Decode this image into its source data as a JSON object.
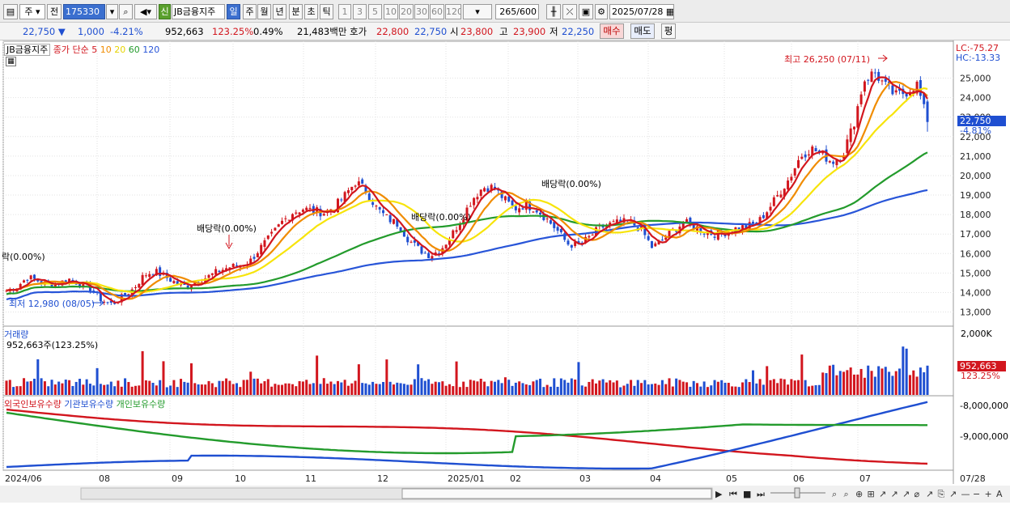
{
  "toolbar": {
    "period_unit": "주",
    "prev": "전",
    "code": "175330",
    "name": "JB금융지주",
    "credit_badge": "신",
    "period_tabs": [
      "일",
      "주",
      "월",
      "년",
      "분",
      "초",
      "틱"
    ],
    "minute_steps": [
      "1",
      "3",
      "5",
      "10",
      "20",
      "30",
      "60",
      "120"
    ],
    "count": "265",
    "count_max": "/600",
    "date": "2025/07/28"
  },
  "infobar": {
    "price": "22,750",
    "change": "1,000",
    "change_pct": "-4.21%",
    "volume": "952,663",
    "volume_pct": "123.25%",
    "turnover_pct": "0.49%",
    "amount": "21,483백만",
    "quote_label": "호가",
    "ask": "22,800",
    "bid": "22,750",
    "open_label": "시",
    "open": "23,800",
    "high_label": "고",
    "high": "23,900",
    "low_label": "저",
    "low": "22,250",
    "buy_button": "매수",
    "sell_button": "매도",
    "eval_button": "평"
  },
  "price_panel": {
    "legend_name": "JB금융지주",
    "legend_ma": "종가 단순",
    "ma_periods": [
      "5",
      "10",
      "20",
      "60",
      "120"
    ],
    "lc": "LC:-75.27",
    "hc": "HC:-13.33",
    "current_price": "22,750",
    "current_pct": "-4.81%",
    "annotation_high": "최고 26,250 (07/11)",
    "annotation_low": "최저 12,980 (08/05)",
    "dividend_1": "배당락(0.00%)",
    "dividend_2": "배당락(0.00%)",
    "dividend_3": "배당락(0.00%)",
    "dividend_0": "락(0.00%)"
  },
  "volume_panel": {
    "title": "거래량",
    "value": "952,663주(123.25%)",
    "axis_top": "2,000K",
    "current": "952,663",
    "current_pct": "123.25%"
  },
  "holding_panel": {
    "series_labels": [
      "외국인보유수량",
      "기관보유수량",
      "개인보유수량"
    ],
    "axis_top": "-8,000,000",
    "axis_mid": "-9,000,000"
  },
  "colors": {
    "up": "#d2161e",
    "down": "#1f4fd1",
    "ma5": "#d2161e",
    "ma10": "#f08c00",
    "ma20": "#f7e40b",
    "ma60": "#239b2c",
    "ma120": "#2855d8"
  },
  "chart_data": {
    "type": "line",
    "title": "JB금융지주",
    "x_ticks": [
      "2024/06",
      "08",
      "09",
      "10",
      "11",
      "12",
      "2025/01",
      "02",
      "03",
      "04",
      "05",
      "06",
      "07",
      "07/28"
    ],
    "y_ticks": [
      13000,
      14000,
      15000,
      16000,
      17000,
      18000,
      19000,
      20000,
      21000,
      22000,
      23000,
      24000,
      25000
    ],
    "ylim": [
      12400,
      26600
    ],
    "series": [
      {
        "name": "종가",
        "values": [
          14100,
          14300,
          14800,
          14600,
          14400,
          14500,
          14700,
          14400,
          14200,
          13600,
          13400,
          13800,
          14200,
          14900,
          15100,
          14800,
          14500,
          14300,
          14600,
          14800,
          15100,
          15300,
          15400,
          15600,
          16300,
          16900,
          17600,
          18100,
          18300,
          18200,
          18100,
          18400,
          19000,
          19700,
          19200,
          18300,
          17800,
          17500,
          16700,
          16200,
          15900,
          16200,
          16900,
          17800,
          18800,
          19400,
          19400,
          18800,
          18300,
          18500,
          18300,
          17800,
          17200,
          16500,
          16400,
          16800,
          17300,
          17500,
          17600,
          17600,
          17200,
          16300,
          16700,
          17200,
          17600,
          17400,
          17100,
          17000,
          17100,
          17300,
          17400,
          17600,
          18300,
          19100,
          19900,
          21000,
          21400,
          21100,
          20700,
          21100,
          22600,
          24900,
          25300,
          24600,
          24100,
          24300,
          24700,
          22750
        ]
      },
      {
        "name": "5",
        "values": []
      },
      {
        "name": "10",
        "values": []
      },
      {
        "name": "20",
        "values": []
      },
      {
        "name": "60",
        "values": []
      },
      {
        "name": "120",
        "values": []
      }
    ]
  }
}
